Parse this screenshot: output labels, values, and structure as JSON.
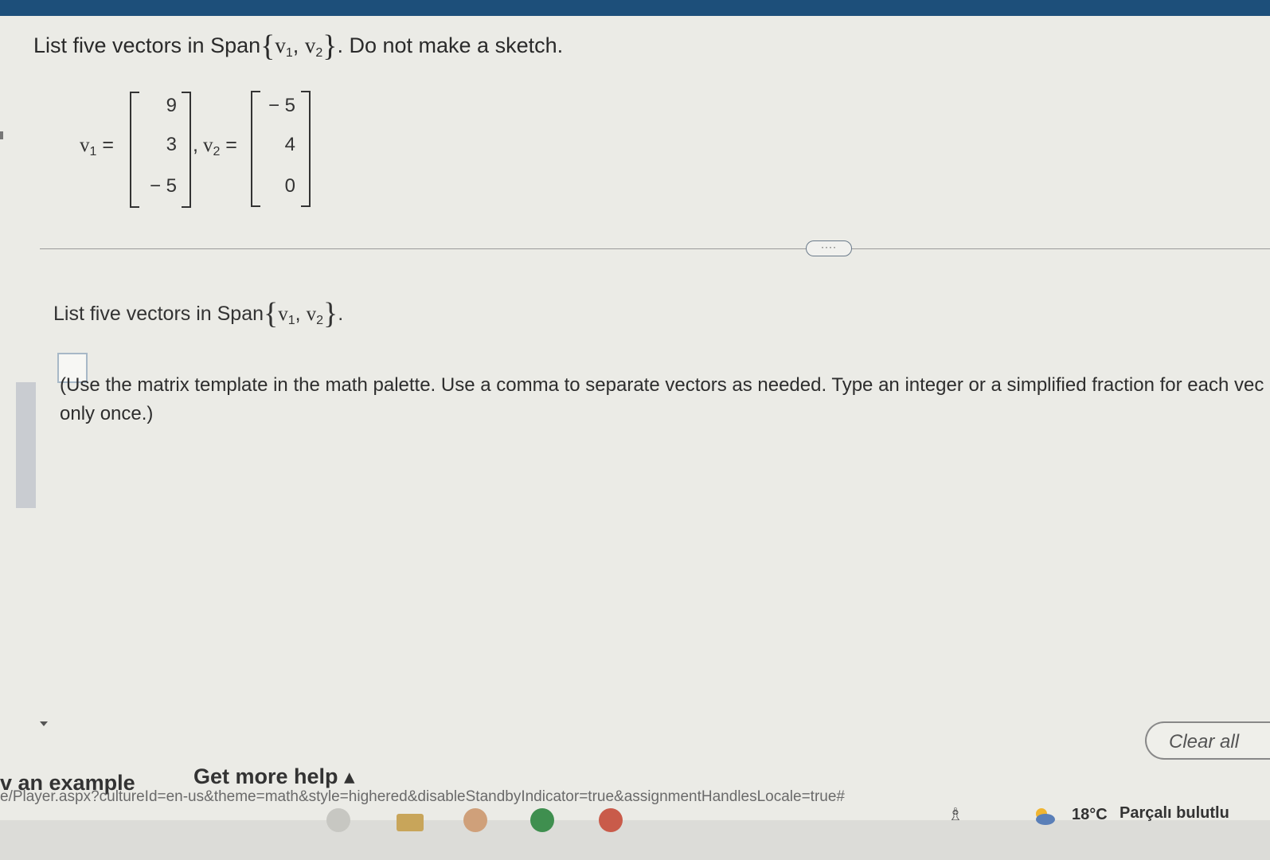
{
  "question": {
    "title_prefix": "List five vectors in Span",
    "title_suffix": ". Do not make a sketch.",
    "span_v1": "v",
    "span_v1_sub": "1",
    "span_sep": ", ",
    "span_v2": "v",
    "span_v2_sub": "2",
    "brace_open": "{",
    "brace_close": "}"
  },
  "vectors": {
    "v1_label": "v",
    "v1_sub": "1",
    "v1_eq": " =",
    "v1_values": [
      "9",
      "3",
      "− 5"
    ],
    "comma": ",",
    "v2_label": "v",
    "v2_sub": "2",
    "v2_eq": " =",
    "v2_values": [
      "− 5",
      "4",
      "0"
    ]
  },
  "separator": {
    "more_button": "····"
  },
  "subquestion": {
    "text": "List five vectors in Span",
    "end": "."
  },
  "answer": {
    "hint_line1": "(Use the matrix template in the math palette. Use a comma to separate vectors as needed. Type an integer or a simplified fraction for each vec",
    "hint_line2": "only once.)"
  },
  "footer": {
    "example_link": "v an example",
    "help_link": "Get more help ▴",
    "clear_button": "Clear all"
  },
  "browser": {
    "status_url": "e/Player.aspx?cultureId=en-us&theme=math&style=highered&disableStandbyIndicator=true&assignmentHandlesLocale=true#"
  },
  "taskbar": {
    "temperature": "18°C",
    "weather_desc": "Parçalı bulutlu"
  },
  "colors": {
    "topbar": "#1d4f7a",
    "panel": "#ebebe6",
    "answer_box_border": "#a7b8c7"
  }
}
